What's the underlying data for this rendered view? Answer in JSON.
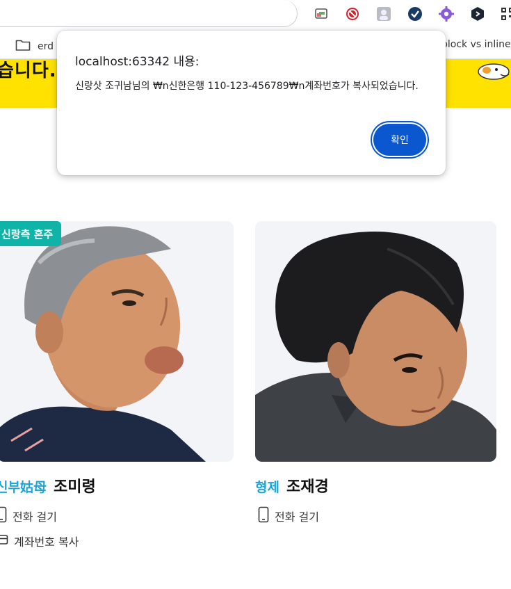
{
  "browser": {
    "bookmarks": {
      "folder_label": "erd",
      "right_label": "block vs inline"
    },
    "extensions": [
      "cast-icon",
      "blocker-icon",
      "profile-extension-icon",
      "check-extension-icon",
      "gear-extension-icon",
      "code-extension-icon",
      "qr-icon"
    ]
  },
  "banner": {
    "partial_text": "습니다."
  },
  "cards": [
    {
      "badge": "신랑측 혼주",
      "relation": "신부姑母",
      "name": "조미령",
      "call_label": "전화 걸기",
      "copy_label": "계좌번호 복사"
    },
    {
      "relation": "형제",
      "name": "조재경",
      "call_label": "전화 걸기"
    }
  ],
  "dialog": {
    "title": "localhost:63342 내용:",
    "message": "신랑삿 조귀남님의 ₩n신한은행 110-123-456789₩n계좌번호가 복사되었습니다.",
    "ok_label": "확인"
  },
  "colors": {
    "banner": "#ffe200",
    "badge": "#10b3a8",
    "relation": "#1ea3d6",
    "dialog_button": "#0b57d0"
  }
}
